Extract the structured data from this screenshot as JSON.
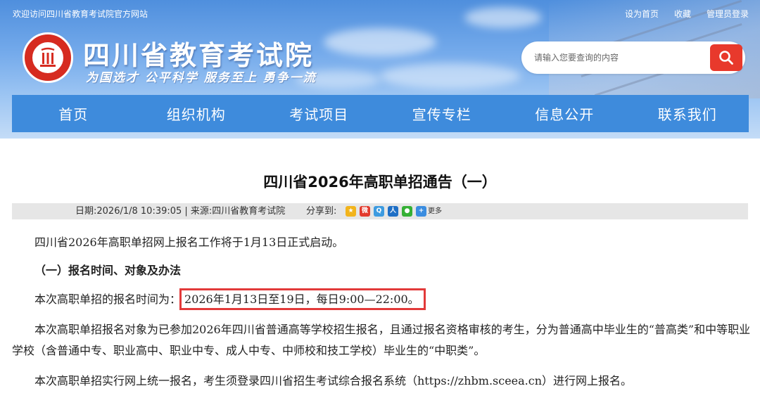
{
  "topbar": {
    "welcome": "欢迎访问四川省教育考试院官方网站",
    "links": [
      "设为首页",
      "收藏",
      "管理员登录"
    ]
  },
  "brand": {
    "title": "四川省教育考试院",
    "motto": "为国选才 公平科学 服务至上 勇争一流",
    "logo_color": "#d62b20"
  },
  "search": {
    "placeholder": "请输入您要查询的内容",
    "button_icon": "search-icon",
    "button_color": "#e8392c"
  },
  "nav": {
    "color": "#3e8bdc",
    "items": [
      "首页",
      "组织机构",
      "考试项目",
      "宣传专栏",
      "信息公开",
      "联系我们"
    ]
  },
  "article": {
    "title": "四川省2026年高职单招通告（一）",
    "meta": "日期:2026/1/8 10:39:05 | 来源:四川省教育考试院",
    "share_label": "分享到:",
    "share_icons": [
      "qzone-icon",
      "weibo-icon",
      "tencent-weibo-icon",
      "renren-icon",
      "wechat-icon",
      "more-icon"
    ],
    "share_more": "更多",
    "p1": "四川省2026年高职单招网上报名工作将于1月13日正式启动。",
    "section_heading": "（一）报名时间、对象及办法",
    "p3_prefix": "本次高职单招的报名时间为：",
    "p3_highlight": "2026年1月13日至19日，每日9:00—22:00。",
    "highlight_color": "#e23a3a",
    "p4": "本次高职单招报名对象为已参加2026年四川省普通高等学校招生报名，且通过报名资格审核的考生，分为普通高中毕业生的“普高类”和中等职业学校（含普通中专、职业高中、职业中专、成人中专、中师校和技工学校）毕业生的“中职类”。",
    "p5": "本次高职单招实行网上统一报名，考生须登录四川省招生考试综合报名系统（https://zhbm.sceea.cn）进行网上报名。"
  }
}
